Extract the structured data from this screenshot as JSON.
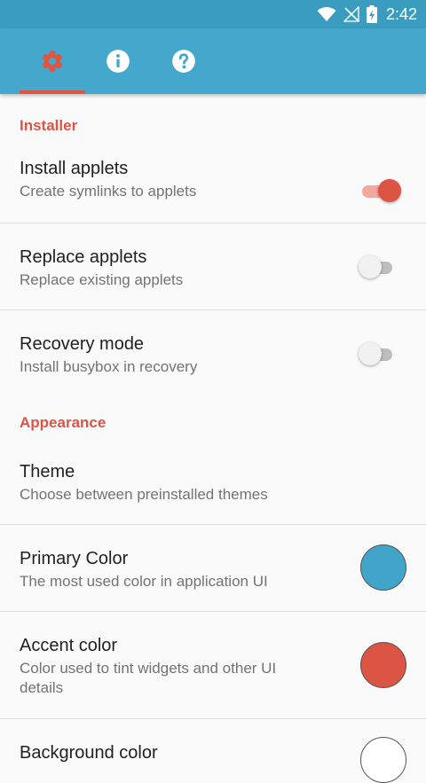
{
  "status_bar": {
    "time": "2:42"
  },
  "tabs": [
    {
      "icon": "gear-icon",
      "selected": true
    },
    {
      "icon": "info-icon",
      "selected": false
    },
    {
      "icon": "help-icon",
      "selected": false
    }
  ],
  "colors": {
    "status_bar": "#3a9cbf",
    "toolbar": "#44a7cc",
    "accent": "#dc5443",
    "primary_swatch": "#41a4ca",
    "accent_swatch": "#dc5443",
    "background_swatch": "#ffffff"
  },
  "categories": {
    "installer": "Installer",
    "appearance": "Appearance"
  },
  "prefs": {
    "install_applets": {
      "title": "Install applets",
      "summary": "Create symlinks to applets",
      "checked": true
    },
    "replace_applets": {
      "title": "Replace applets",
      "summary": "Replace existing applets",
      "checked": false
    },
    "recovery_mode": {
      "title": "Recovery mode",
      "summary": "Install busybox in recovery",
      "checked": false
    },
    "theme": {
      "title": "Theme",
      "summary": "Choose between preinstalled themes"
    },
    "primary_color": {
      "title": "Primary Color",
      "summary": "The most used color in application UI"
    },
    "accent_color": {
      "title": "Accent color",
      "summary": "Color used to tint widgets and other UI details"
    },
    "background_color": {
      "title": "Background color"
    }
  }
}
